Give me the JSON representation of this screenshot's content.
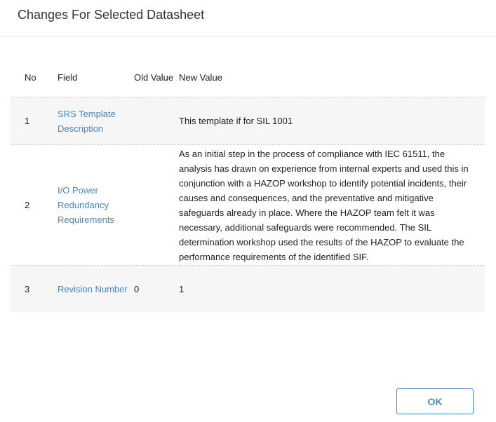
{
  "dialog": {
    "title": "Changes For Selected Datasheet"
  },
  "table": {
    "headers": {
      "no": "No",
      "field": "Field",
      "old_value": "Old Value",
      "new_value": "New Value"
    },
    "rows": [
      {
        "no": "1",
        "field": "SRS Template Description",
        "old_value": "",
        "new_value": "This template if for SIL 1001"
      },
      {
        "no": "2",
        "field": "I/O Power Redundancy Requirements",
        "old_value": "",
        "new_value": "As an initial step in the process of compliance with IEC 61511, the analysis has drawn on experience from internal experts and used this in conjunction with a HAZOP workshop to identify potential incidents, their causes and consequences, and the preventative and mitigative safeguards already in place. Where the HAZOP team felt it was necessary, additional safeguards were recommended. The SIL determination workshop used the results of the HAZOP to evaluate the performance requirements of the identified SIF."
      },
      {
        "no": "3",
        "field": "Revision Number",
        "old_value": "0",
        "new_value": "1"
      }
    ]
  },
  "footer": {
    "ok_label": "OK"
  },
  "colors": {
    "link": "#4a86c5",
    "row_shade": "#f6f6f6"
  }
}
